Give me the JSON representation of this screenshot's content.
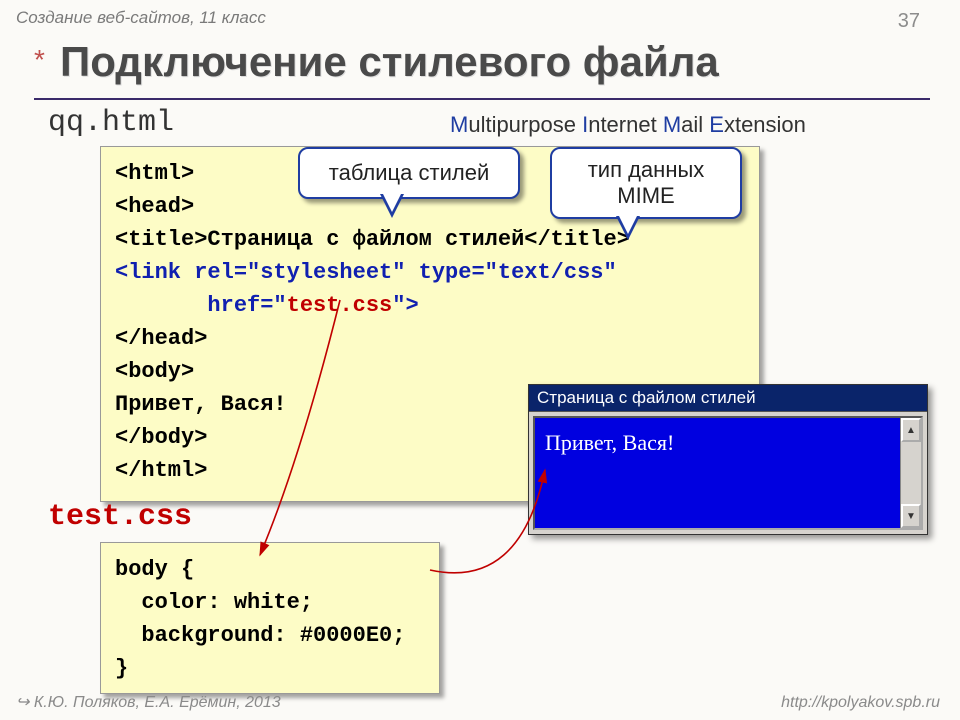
{
  "header": "Создание веб-сайтов, 11 класс",
  "pagenum": "37",
  "star": "*",
  "title": "Подключение стилевого файла",
  "filename_html": "qq.html",
  "mime": {
    "M": "M",
    "w1": "ultipurpose ",
    "I": "I",
    "w2": "nternet ",
    "Ma": "M",
    "w3": "ail ",
    "E": "E",
    "w4": "xtension"
  },
  "code": {
    "l1": "<html>",
    "l2": "<head>",
    "l3a": "<title>",
    "l3b": "Страница с файлом стилей",
    "l3c": "</title>",
    "l4": "<link rel=\"stylesheet\" type=\"text/css\"",
    "l5a": "       href=\"",
    "l5b": "test.css",
    "l5c": "\">",
    "l6": "</head>",
    "l7": "<body>",
    "l8": "Привет, Вася!",
    "l9": "</body>",
    "l10": "</html>"
  },
  "callout1": "таблица стилей",
  "callout2": "тип данных MIME",
  "filename_css": "test.css",
  "css_code": {
    "l1": "body {",
    "l2": "  color: white;",
    "l3": "  background: #0000E0;",
    "l4": "}"
  },
  "preview": {
    "title": "Страница с файлом стилей",
    "body": "Привет, Вася!"
  },
  "footer_left": "↪ К.Ю. Поляков, Е.А. Ерёмин, 2013",
  "footer_right": "http://kpolyakov.spb.ru"
}
